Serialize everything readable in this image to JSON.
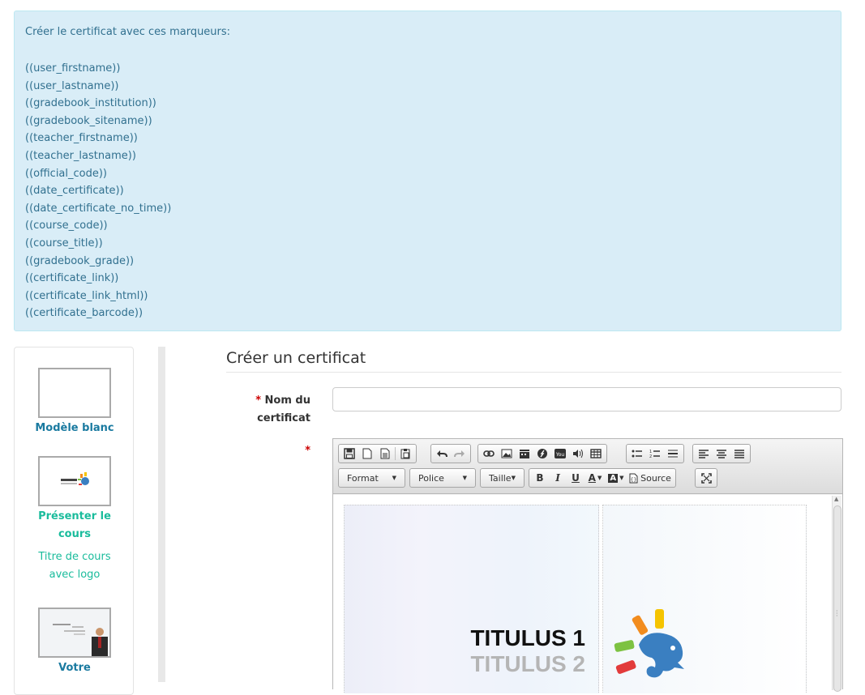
{
  "info": {
    "intro": "Créer le certificat avec ces marqueurs:",
    "markers": [
      "((user_firstname))",
      "((user_lastname))",
      "((gradebook_institution))",
      "((gradebook_sitename))",
      "((teacher_firstname))",
      "((teacher_lastname))",
      "((official_code))",
      "((date_certificate))",
      "((date_certificate_no_time))",
      "((course_code))",
      "((course_title))",
      "((gradebook_grade))",
      "((certificate_link))",
      "((certificate_link_html))",
      "((certificate_barcode))"
    ]
  },
  "templates": [
    {
      "title_line1": "Modèle blanc",
      "title_line2": "",
      "desc_line1": "",
      "desc_line2": ""
    },
    {
      "title_line1": "Présenter le",
      "title_line2": "cours",
      "desc_line1": "Titre de cours",
      "desc_line2": "avec logo"
    },
    {
      "title_line1": "Votre",
      "title_line2": "",
      "desc_line1": "",
      "desc_line2": ""
    }
  ],
  "form": {
    "legend": "Créer un certificat",
    "required_mark": "*",
    "name_label_line1": "Nom du",
    "name_label_line2": "certificat",
    "name_value": ""
  },
  "editor": {
    "combos": [
      "Format",
      "Police",
      "Taille"
    ],
    "source_label": "Source",
    "bold": "B",
    "italic": "I",
    "underline": "U",
    "font_color": "A",
    "bg_color": "A",
    "content": {
      "title1": "TITULUS 1",
      "title2": "TITULUS 2"
    }
  },
  "colors": {
    "info_bg": "#d9edf7",
    "info_text": "#31708f",
    "link_blue": "#1a7aa0",
    "link_teal": "#1abc9c",
    "required_red": "#cc0000"
  }
}
